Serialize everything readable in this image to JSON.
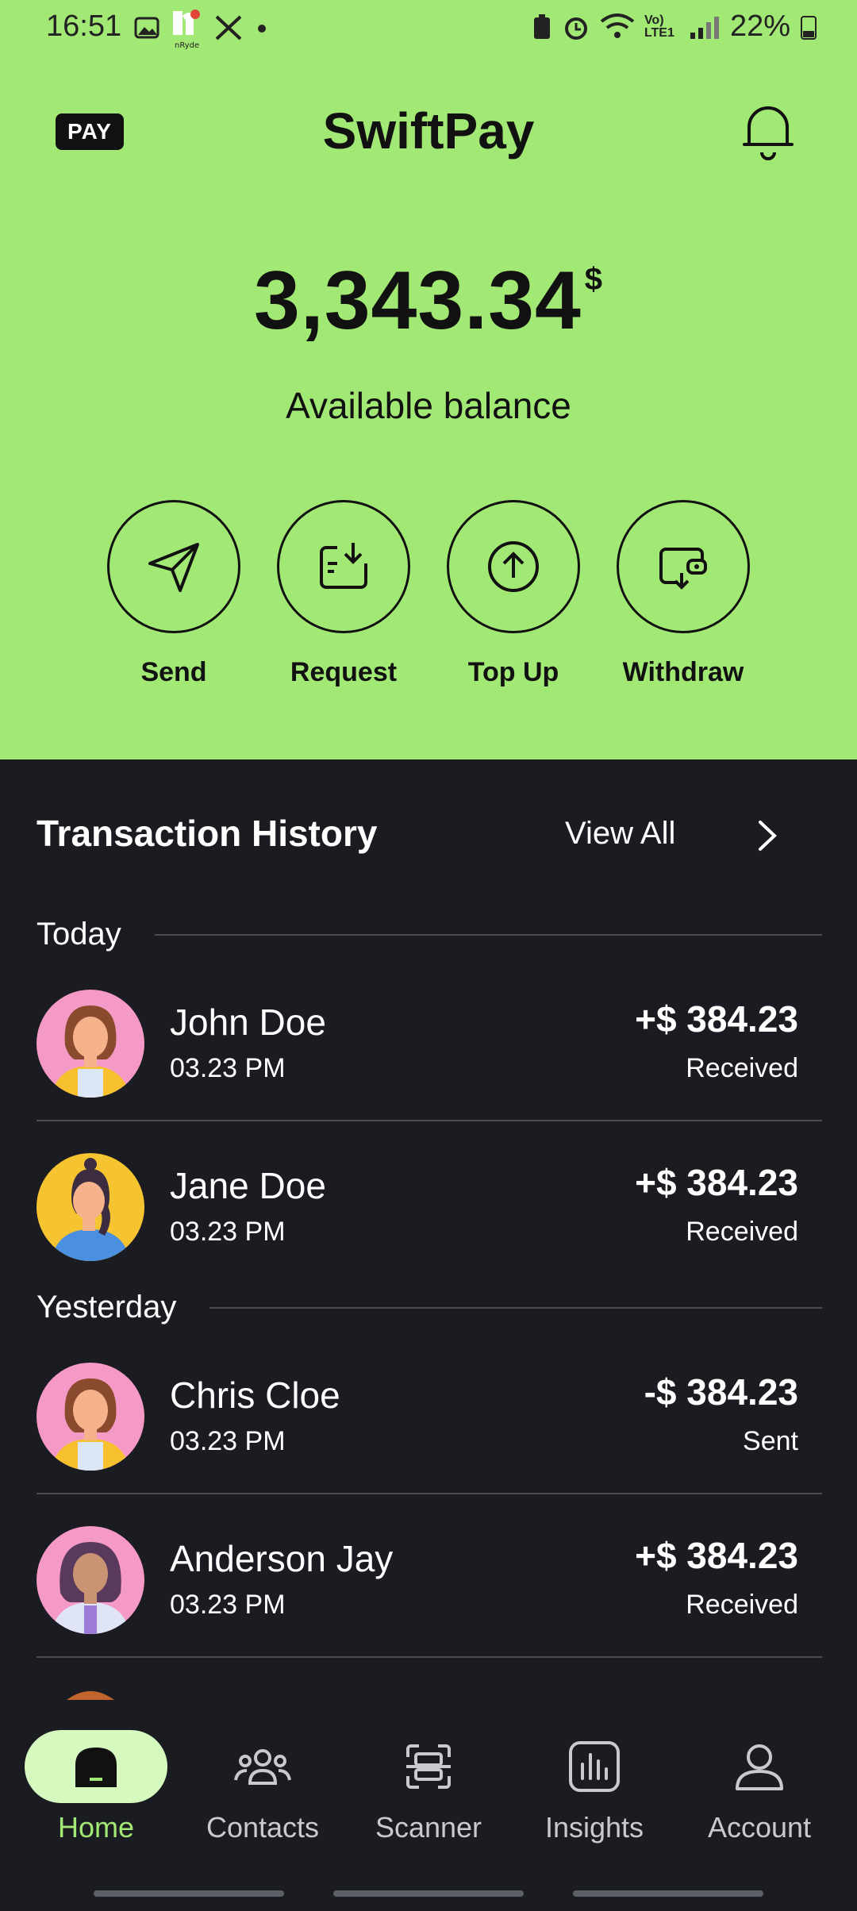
{
  "status": {
    "time": "16:51",
    "battery": "22%",
    "signal_text": "Vo) LTE1"
  },
  "header": {
    "badge": "PAY",
    "title": "SwiftPay"
  },
  "balance": {
    "amount": "3,343.34",
    "currency": "$",
    "label": "Available balance"
  },
  "actions": [
    {
      "label": "Send",
      "icon": "send-icon"
    },
    {
      "label": "Request",
      "icon": "request-icon"
    },
    {
      "label": "Top Up",
      "icon": "top-up-icon"
    },
    {
      "label": "Withdraw",
      "icon": "withdraw-icon"
    }
  ],
  "history": {
    "title": "Transaction History",
    "view_all": "View All",
    "sections": [
      {
        "label": "Today"
      },
      {
        "label": "Yesterday"
      }
    ],
    "transactions": [
      {
        "name": "John Doe",
        "time": "03.23 PM",
        "amount": "+$ 384.23",
        "kind": "Received"
      },
      {
        "name": "Jane Doe",
        "time": "03.23 PM",
        "amount": "+$ 384.23",
        "kind": "Received"
      },
      {
        "name": "Chris Cloe",
        "time": "03.23 PM",
        "amount": "-$ 384.23",
        "kind": "Sent"
      },
      {
        "name": "Anderson Jay",
        "time": "03.23 PM",
        "amount": "+$ 384.23",
        "kind": "Received"
      }
    ]
  },
  "nav": [
    {
      "label": "Home",
      "icon": "home-icon",
      "active": true
    },
    {
      "label": "Contacts",
      "icon": "contacts-icon"
    },
    {
      "label": "Scanner",
      "icon": "scanner-icon"
    },
    {
      "label": "Insights",
      "icon": "insights-icon"
    },
    {
      "label": "Account",
      "icon": "account-icon"
    }
  ],
  "colors": {
    "accent": "#a2e874",
    "background": "#1b1c21",
    "active_pill": "#d6f9bf"
  }
}
